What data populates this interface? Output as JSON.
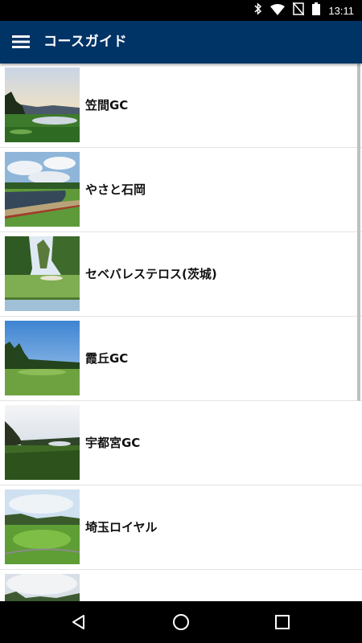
{
  "status_bar": {
    "time": "13:11",
    "icons": [
      "bluetooth-icon",
      "wifi-icon",
      "no-sim-icon",
      "battery-icon"
    ]
  },
  "app_bar": {
    "title": "コースガイド",
    "background": "#003366",
    "menu_icon": "hamburger-menu-icon"
  },
  "courses": [
    {
      "name": "笠間GC"
    },
    {
      "name": "やさと石岡"
    },
    {
      "name": "セベバレステロス(茨城)"
    },
    {
      "name": "霞丘GC"
    },
    {
      "name": "宇都宮GC"
    },
    {
      "name": "埼玉ロイヤル"
    },
    {
      "name": ""
    }
  ],
  "nav_bar": {
    "buttons": [
      "back-icon",
      "home-icon",
      "recents-icon"
    ]
  }
}
